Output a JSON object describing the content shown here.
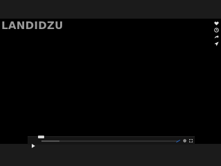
{
  "brand": {
    "logo_text": "LANDIDZU",
    "logo_color": "#9a9a9a"
  },
  "side_actions": [
    {
      "icon": "heart-icon"
    },
    {
      "icon": "clock-icon"
    },
    {
      "icon": "share-icon"
    },
    {
      "icon": "send-icon"
    }
  ],
  "player": {
    "accent_color": "#2a6fd6",
    "progress_fraction": 0.0,
    "buffered_fraction": 0.13,
    "controls": {
      "play": {
        "icon": "play-icon"
      },
      "quality": {
        "icon": "hd-icon"
      },
      "settings": {
        "icon": "gear-icon"
      },
      "fullscreen": {
        "icon": "fullscreen-icon"
      }
    }
  }
}
